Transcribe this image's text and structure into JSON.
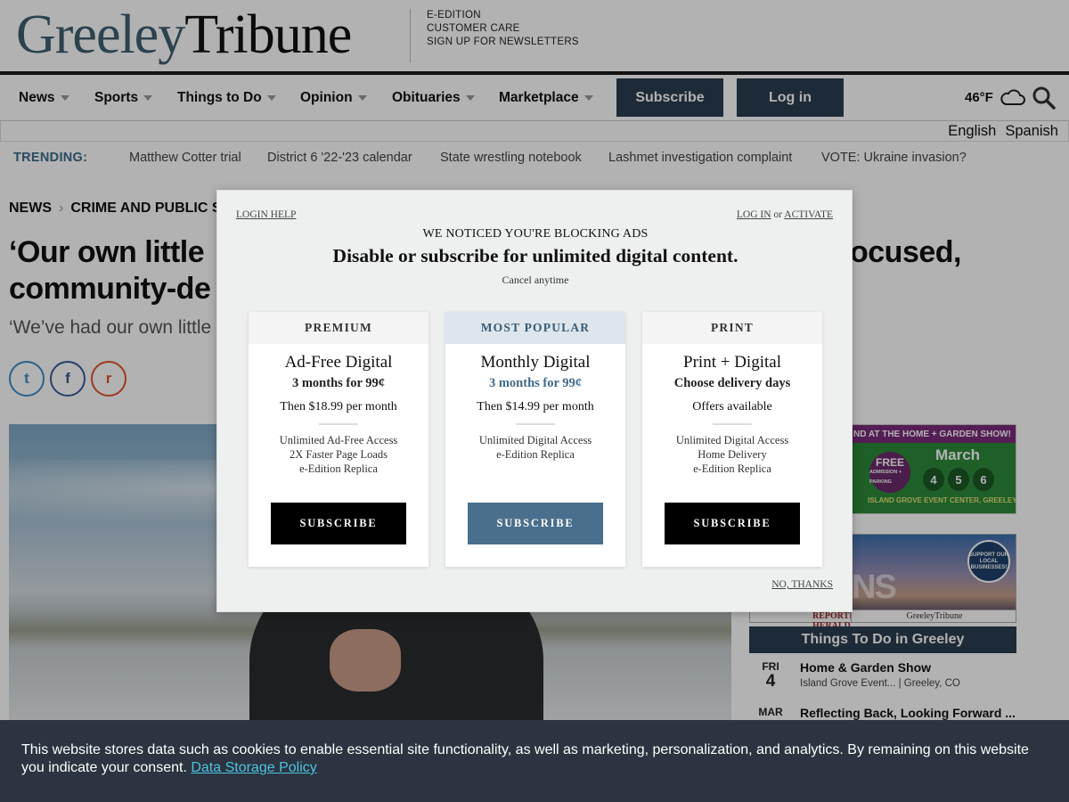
{
  "header": {
    "logo_part1": "Greeley",
    "logo_part2": "Tribune",
    "utility_links": [
      "E-EDITION",
      "CUSTOMER CARE",
      "SIGN UP FOR NEWSLETTERS"
    ]
  },
  "nav": {
    "items": [
      "News",
      "Sports",
      "Things to Do",
      "Opinion",
      "Obituaries",
      "Marketplace"
    ],
    "subscribe_label": "Subscribe",
    "login_label": "Log in",
    "weather": "46°F"
  },
  "languages": [
    "English",
    "Spanish"
  ],
  "trending": {
    "label": "TRENDING:",
    "links": [
      "Matthew Cotter trial",
      "District 6 '22-'23 calendar",
      "State wrestling notebook",
      "Lashmet investigation complaint",
      "VOTE: Ukraine invasion?"
    ]
  },
  "article": {
    "breadcrumb": [
      "NEWS",
      "CRIME AND PUBLIC S"
    ],
    "headline_line1": "‘Our own little",
    "headline_line1_right": "ocused,",
    "headline_line2": "community-de",
    "subhead": "‘We’ve had our own little",
    "share": {
      "twitter": "t",
      "facebook": "f",
      "reddit": "r"
    }
  },
  "ads": {
    "home_show": {
      "band": "ND AT THE HOME + GARDEN SHOW!",
      "free": "FREE",
      "free_sub": "ADMISSION + PARKING",
      "month": "March",
      "days": [
        "4",
        "5",
        "6"
      ],
      "venue": "ISLAND GROVE EVENT CENTER, GREELEY"
    },
    "local": {
      "big": "NS",
      "support": "SUPPORT OUR LOCAL BUSINESSES!",
      "brand1": "REPORTER-HERALD",
      "brand2": "GreeleyTribune"
    }
  },
  "things_to_do": {
    "title": "Things To Do in Greeley",
    "events": [
      {
        "dow": "FRI",
        "day": "4",
        "title": "Home & Garden Show",
        "meta": "Island Grove Event... | Greeley, CO"
      },
      {
        "dow": "MAR",
        "day": "",
        "title": "Reflecting Back, Looking Forward ...",
        "meta": ""
      }
    ]
  },
  "modal": {
    "login_help": "LOGIN HELP",
    "log_in": "LOG IN",
    "or": "or",
    "activate": "ACTIVATE",
    "notice": "WE NOTICED YOU'RE BLOCKING ADS",
    "headline": "Disable or subscribe for unlimited digital content.",
    "cancel": "Cancel anytime",
    "plans": [
      {
        "header": "PREMIUM",
        "title": "Ad-Free Digital",
        "promo": "3 months for 99¢",
        "price": "Then $18.99 per month",
        "features": [
          "Unlimited Ad-Free Access",
          "2X Faster Page Loads",
          "e-Edition Replica"
        ],
        "button": "SUBSCRIBE"
      },
      {
        "header": "MOST POPULAR",
        "title": "Monthly Digital",
        "promo": "3 months for 99¢",
        "price": "Then $14.99 per month",
        "features": [
          "Unlimited Digital Access",
          "e-Edition Replica"
        ],
        "button": "SUBSCRIBE"
      },
      {
        "header": "PRINT",
        "title": "Print + Digital",
        "promo": "Choose delivery days",
        "price": "Offers available",
        "features": [
          "Unlimited Digital Access",
          "Home Delivery",
          "e-Edition Replica"
        ],
        "button": "SUBSCRIBE"
      }
    ],
    "no_thanks": "NO, THANKS"
  },
  "cookie": {
    "text": "This website stores data such as cookies to enable essential site functionality, as well as marketing, personalization, and analytics. By remaining on this website you indicate your consent.",
    "link": "Data Storage Policy"
  },
  "colors": {
    "nav_button": "#2a3d4f",
    "popular_accent": "#4a6f8c",
    "trending_label": "#3a6a8a",
    "cookie_bg": "#2b3440",
    "cookie_link": "#4ec3e0"
  }
}
